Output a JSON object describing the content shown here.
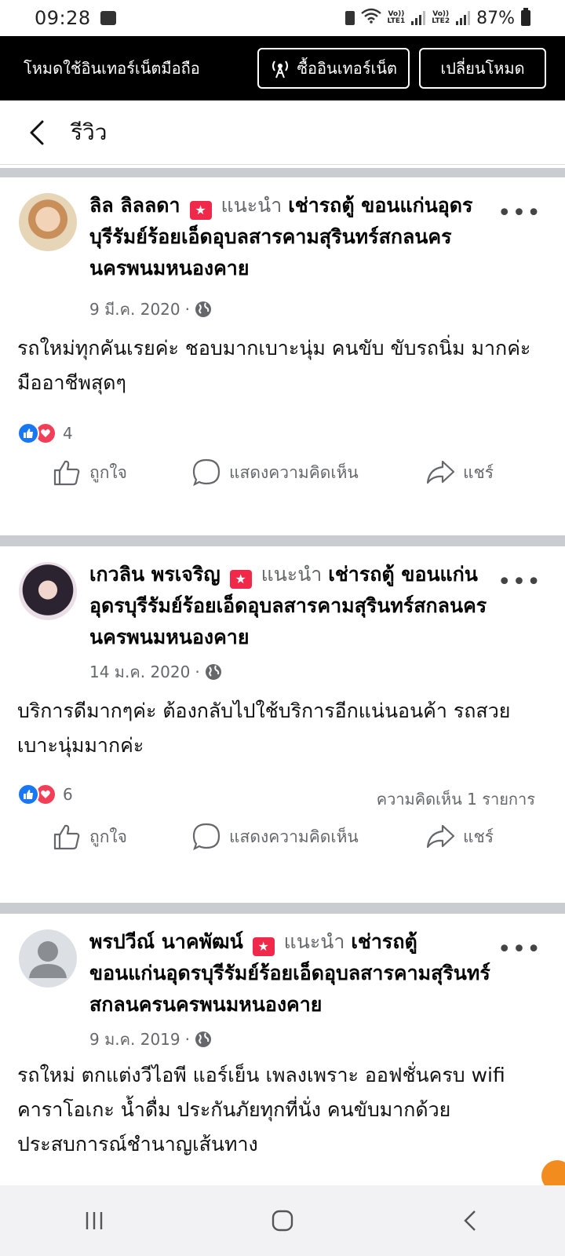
{
  "status_bar": {
    "time": "09:28",
    "battery": "87%",
    "sim1": "LTE1",
    "sim2": "LTE2",
    "volte": "Vo))"
  },
  "mode_bar": {
    "text": "โหมดใช้อินเทอร์เน็ตมือถือ",
    "buy_label": "ซื้ออินเทอร์เน็ต",
    "switch_label": "เปลี่ยนโหมด"
  },
  "header": {
    "title": "รีวิว"
  },
  "posts": [
    {
      "name": "ลิล ลิลลดา",
      "recommend": "แนะนำ",
      "page": "เช่ารถตู้ ขอนแก่นอุดรบุรีรัมย์ร้อยเอ็ดอุบลสารคามสุรินทร์สกลนครนครพนมหนองคาย",
      "date": "9 มี.ค. 2020",
      "body": "รถใหม่ทุกคันเรยค่ะ ชอบมากเบาะนุ่ม คนขับ ขับรถนิ่ม มากค่ะ มืออาชีพสุดๆ",
      "reactions": "4",
      "comments": ""
    },
    {
      "name": "เกวลิน พรเจริญ",
      "recommend": "แนะนำ",
      "page": "เช่ารถตู้ ขอนแก่นอุดรบุรีรัมย์ร้อยเอ็ดอุบลสารคามสุรินทร์สกลนครนครพนมหนองคาย",
      "date": "14 ม.ค. 2020",
      "body": "บริการดีมากๆค่ะ ต้องกลับไปใช้บริการอีกแน่นอนค้า รถสวย เบาะนุ่มมากค่ะ",
      "reactions": "6",
      "comments": "ความคิดเห็น 1 รายการ"
    },
    {
      "name": "พรปวีณ์ นาคพัฒน์",
      "recommend": "แนะนำ",
      "page": "เช่ารถตู้ ขอนแก่นอุดรบุรีรัมย์ร้อยเอ็ดอุบลสารคามสุรินทร์สกลนครนครพนมหนองคาย",
      "date": "9 ม.ค. 2019",
      "body": "รถใหม่ ตกแต่งวีไอพี  แอร์เย็น เพลงเพราะ ออฟชั่นครบ wifi คาราโอเกะ น้ำดื่ม ประกันภัยทุกที่นั่ง คนขับมากด้วยประสบการณ์ชำนาญเส้นทาง"
    }
  ],
  "actions": {
    "like": "ถูกใจ",
    "comment": "แสดงความคิดเห็น",
    "share": "แชร์"
  },
  "icons": [
    "back-arrow-icon",
    "globe-icon",
    "like-icon",
    "comment-icon",
    "share-icon",
    "more-icon",
    "antenna-icon"
  ]
}
